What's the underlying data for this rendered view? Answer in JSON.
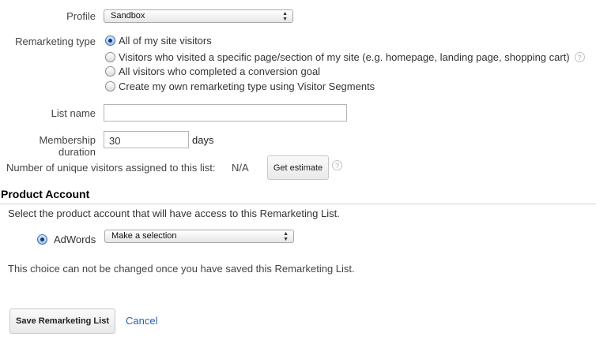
{
  "profile": {
    "label": "Profile",
    "selected": "Sandbox"
  },
  "remarketing_type": {
    "label": "Remarketing type",
    "options": [
      {
        "label": "All of my site visitors"
      },
      {
        "label": "Visitors who visited a specific page/section of my site (e.g. homepage, landing page, shopping cart)"
      },
      {
        "label": "All visitors who completed a conversion goal"
      },
      {
        "label": "Create my own remarketing type using Visitor Segments"
      }
    ],
    "selected_index": 0
  },
  "list_name": {
    "label": "List name",
    "value": ""
  },
  "membership": {
    "label": "Membership duration",
    "value": "30",
    "unit": "days"
  },
  "estimate": {
    "label": "Number of unique visitors assigned to this list:",
    "value": "N/A",
    "button": "Get estimate"
  },
  "product_account": {
    "title": "Product Account",
    "description": "Select the product account that will have access to this Remarketing List.",
    "option_label": "AdWords",
    "select_value": "Make a selection",
    "note": "This choice can not be changed once you have saved this Remarketing List."
  },
  "actions": {
    "save": "Save Remarketing List",
    "cancel": "Cancel"
  },
  "icons": {
    "help": "?",
    "select_arrows_up": "▲",
    "select_arrows_down": "▼"
  },
  "colors": {
    "link": "#2a5db0",
    "radio_selected": "#3a6fb5"
  }
}
